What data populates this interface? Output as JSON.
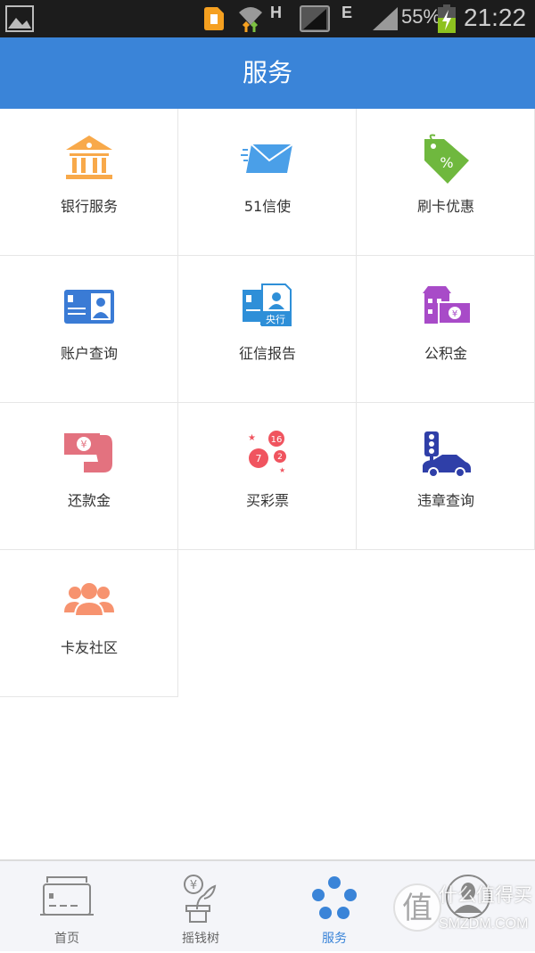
{
  "status_bar": {
    "network_1": "H",
    "network_2": "E",
    "battery": "55%",
    "time": "21:22"
  },
  "header": {
    "title": "服务"
  },
  "services": [
    {
      "label": "银行服务",
      "icon": "bank-icon",
      "color": "#f8a94a"
    },
    {
      "label": "51信使",
      "icon": "mail-icon",
      "color": "#4a9fe8"
    },
    {
      "label": "刷卡优惠",
      "icon": "discount-tag-icon",
      "color": "#6fb83e"
    },
    {
      "label": "账户查询",
      "icon": "id-card-icon",
      "color": "#3a7bd5"
    },
    {
      "label": "征信报告",
      "icon": "credit-report-icon",
      "color": "#2e8fd8",
      "badge": "央行"
    },
    {
      "label": "公积金",
      "icon": "housing-fund-icon",
      "color": "#a84bc8"
    },
    {
      "label": "还款金",
      "icon": "repay-money-icon",
      "color": "#e3727f"
    },
    {
      "label": "买彩票",
      "icon": "lottery-balls-icon",
      "color": "#f0545f",
      "numbers": [
        "16",
        "7",
        "2"
      ]
    },
    {
      "label": "违章查询",
      "icon": "traffic-light-car-icon",
      "color": "#2f3fa8"
    },
    {
      "label": "卡友社区",
      "icon": "community-users-icon",
      "color": "#f7936f"
    }
  ],
  "tabbar": {
    "active_color": "#3a84d8",
    "items": [
      {
        "label": "首页",
        "icon": "card-home-icon",
        "active": false
      },
      {
        "label": "摇钱树",
        "icon": "money-tree-icon",
        "active": false
      },
      {
        "label": "服务",
        "icon": "services-dots-icon",
        "active": true
      },
      {
        "icon": "user-avatar-icon",
        "active": false
      }
    ]
  },
  "watermark": {
    "text": "什么值得买",
    "site": "SMZDM.COM",
    "glyph": "值"
  }
}
